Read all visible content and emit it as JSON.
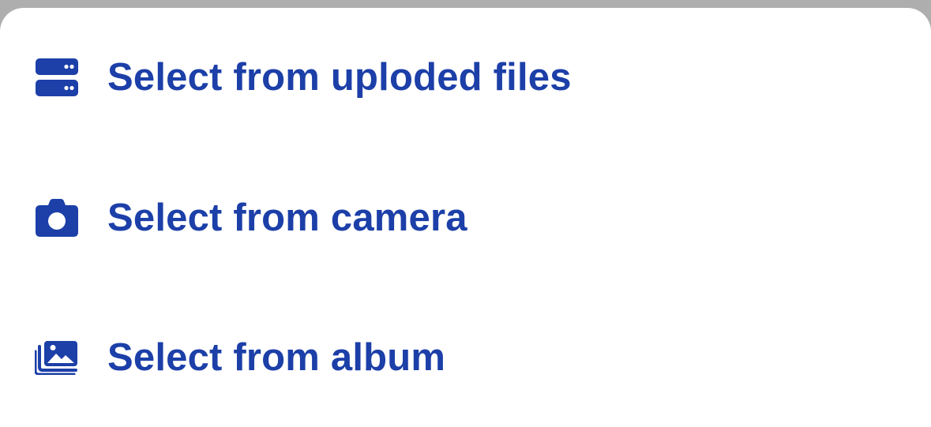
{
  "colors": {
    "accent": "#1c3fa8",
    "sheet_background": "#ffffff",
    "backdrop": "#aeaeae"
  },
  "action_sheet": {
    "options": [
      {
        "label": "Select from uploded files",
        "icon": "server-icon"
      },
      {
        "label": "Select from camera",
        "icon": "camera-icon"
      },
      {
        "label": "Select from album",
        "icon": "photo-album-icon"
      }
    ]
  }
}
